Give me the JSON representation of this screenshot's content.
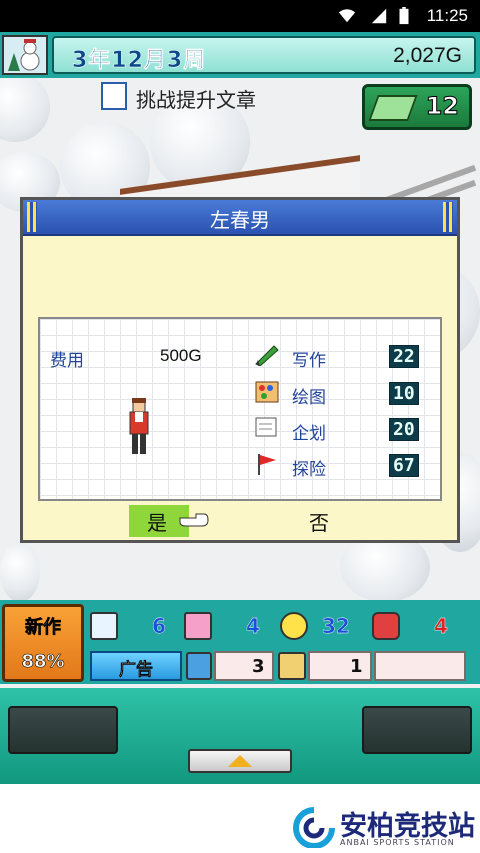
{
  "status_bar": {
    "time": "11:25"
  },
  "top_bar": {
    "date": "3年12月3周",
    "money": "2,027G",
    "book_count": "12"
  },
  "dialog": {
    "title": "左春男",
    "subtitle": "挑战提升文章",
    "cost_label": "费用",
    "cost_value": "500G",
    "stats": [
      {
        "label": "写作",
        "value": "22",
        "icon": "pencil-icon"
      },
      {
        "label": "绘图",
        "value": "10",
        "icon": "palette-icon"
      },
      {
        "label": "企划",
        "value": "20",
        "icon": "planning-icon"
      },
      {
        "label": "探险",
        "value": "67",
        "icon": "flag-icon"
      }
    ],
    "yes": "是",
    "no": "否"
  },
  "bottom": {
    "new_label": "新作",
    "new_percent": "88%",
    "counts": [
      "6",
      "4",
      "32",
      "4"
    ],
    "ad_label": "广告",
    "cell_values": [
      "3",
      "1"
    ]
  },
  "watermark": {
    "text": "安柏竞技站",
    "sub": "ANBAI SPORTS STATION"
  },
  "colors": {
    "accent": "#1fa7a0",
    "yes_highlight": "#8fd63a",
    "title_blue": "#2b52b0"
  }
}
